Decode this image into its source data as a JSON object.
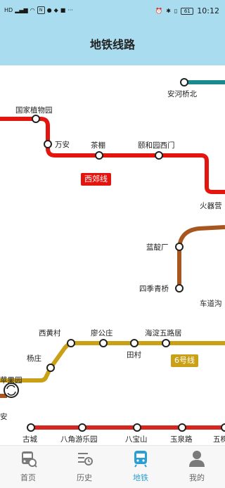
{
  "status_bar": {
    "left_icons": [
      "hd-icon",
      "signal-icon",
      "wifi-icon",
      "nfc-icon",
      "app-icon",
      "app-icon",
      "app-icon",
      "more-dots-icon"
    ],
    "right_icons": [
      "alarm-icon",
      "bluetooth-icon",
      "vibrate-icon",
      "battery-icon"
    ],
    "battery": "61",
    "time": "10:12"
  },
  "header": {
    "title": "地铁线路"
  },
  "map": {
    "lines": {
      "xijiao_color": "#e4140f",
      "line6_color": "#c9a016",
      "brown_color": "#a8561f",
      "teal_color": "#1a8a8a",
      "line10_color": "#d7261f"
    },
    "stations": {
      "anhe_qiaobei": "安河桥北",
      "guojia_zhiwuyuan": "国家植物园",
      "wanan": "万安",
      "chapeng": "茶棚",
      "yiheyuan_ximen": "颐和园西门",
      "huoqiying": "火器营",
      "landianchang": "蓝靛厂",
      "siji_qingqiao": "四季青桥",
      "chedaogou": "车道沟",
      "xihuangcun": "西黄村",
      "liaogongzhuang": "廖公庄",
      "tiancun": "田村",
      "haidian_wuluju": "海淀五路居",
      "yangzhuang": "杨庄",
      "pingguoyuan": "苹果园",
      "an": "安",
      "gucheng": "古城",
      "bajiao_youleyuan": "八角游乐园",
      "babaoshan": "八宝山",
      "yuquanlu": "玉泉路",
      "wukesong": "五棵"
    },
    "badges": {
      "xijiao": "西郊线",
      "line6": "6号线"
    }
  },
  "tabs": [
    {
      "label": "首页",
      "icon": "bus-icon"
    },
    {
      "label": "历史",
      "icon": "history-icon"
    },
    {
      "label": "地铁",
      "icon": "subway-icon"
    },
    {
      "label": "我的",
      "icon": "profile-icon"
    }
  ],
  "active_tab": "地铁"
}
